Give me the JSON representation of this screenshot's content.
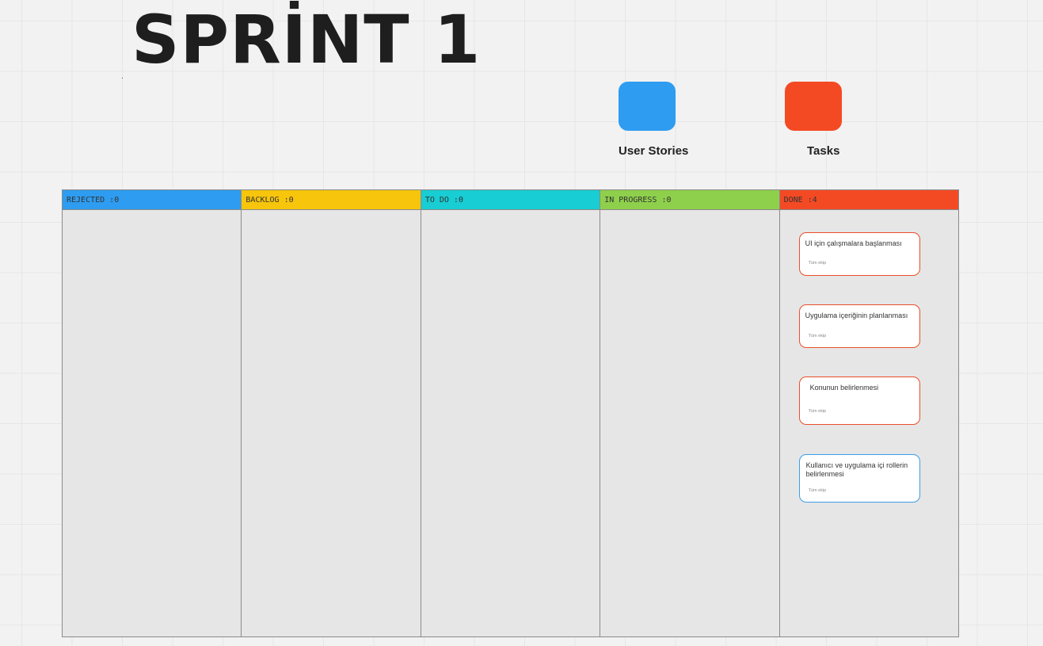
{
  "title": "SPRİNT 1",
  "legend": [
    {
      "label": "User Stories",
      "color": "#2e9cf0"
    },
    {
      "label": "Tasks",
      "color": "#f44a24"
    }
  ],
  "columns": [
    {
      "label": "REJECTED :0",
      "color": "#2e9cf0"
    },
    {
      "label": "BACKLOG :0",
      "color": "#f7c50c"
    },
    {
      "label": "TO DO :0",
      "color": "#18cdd3"
    },
    {
      "label": "IN PROGRESS :0",
      "color": "#8ed04c"
    },
    {
      "label": "DONE :4",
      "color": "#f44a24"
    }
  ],
  "done_cards": [
    {
      "title": "UI için çalışmalara başlanması",
      "owner": "Tüm ekip",
      "type": "task"
    },
    {
      "title": "Uygulama içeriğinin planlanması",
      "owner": "Tüm ekip",
      "type": "task"
    },
    {
      "title": "Konunun belirlenmesi",
      "owner": "Tüm ekip",
      "type": "task"
    },
    {
      "title": "Kullanıcı ve uygulama içi rollerin belirlenmesi",
      "owner": "Tüm ekip",
      "type": "story"
    }
  ]
}
